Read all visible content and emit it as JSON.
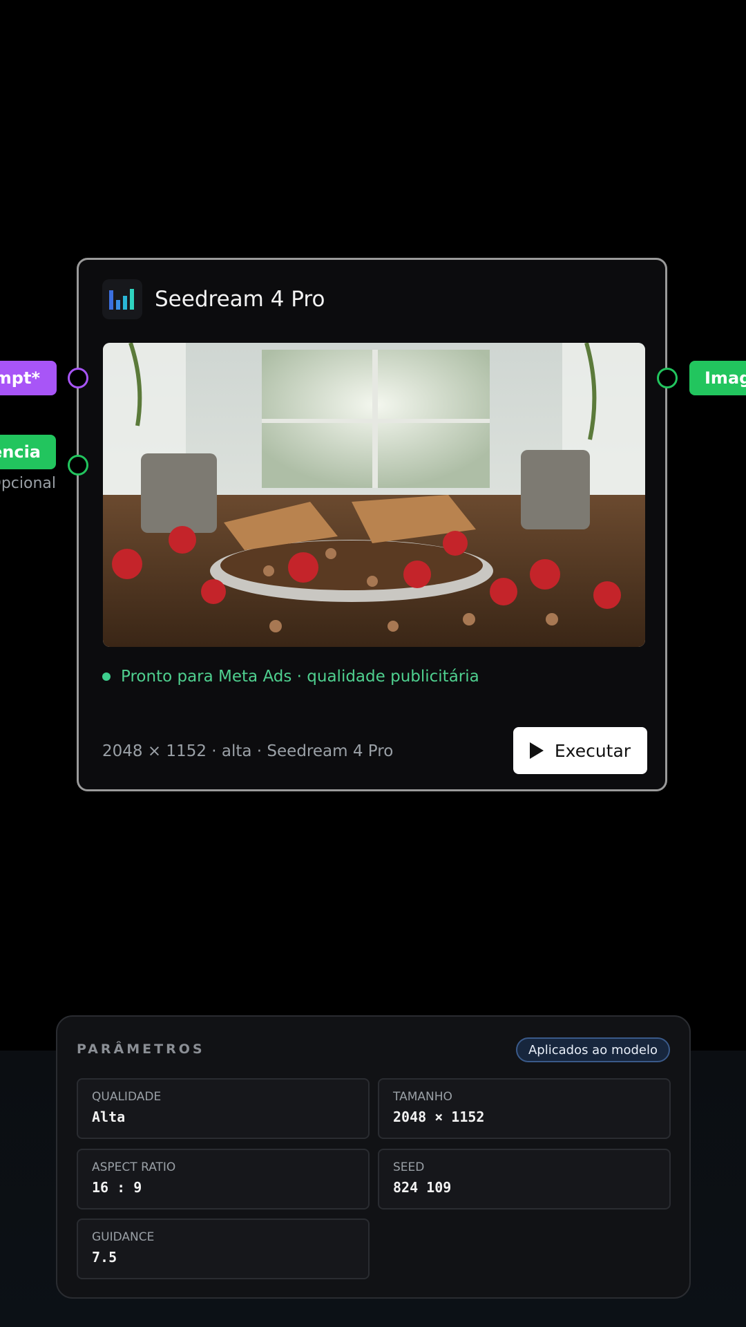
{
  "node": {
    "title": "Seedream 4 Pro",
    "status": "Pronto para Meta Ads · qualidade publicitária",
    "meta": "2048 × 1152 · alta · Seedream 4 Pro",
    "run_label": "Executar",
    "status_color": "#3ecf8e"
  },
  "inputs": {
    "prompt_label": "Prompt*",
    "prompt_visible": "mpt*",
    "reference_visible": "ência",
    "optional_visible": "Opcional",
    "prompt_color": "#a855f7",
    "reference_color": "#22c55e"
  },
  "outputs": {
    "image_visible": "Imag",
    "image_color": "#22c55e"
  },
  "params": {
    "title": "PARÂMETROS",
    "badge": "Aplicados ao modelo",
    "items": [
      {
        "label": "QUALIDADE",
        "value": "Alta"
      },
      {
        "label": "TAMANHO",
        "value": "2048 × 1152"
      },
      {
        "label": "ASPECT RATIO",
        "value": "16 : 9"
      },
      {
        "label": "SEED",
        "value": "824 109"
      },
      {
        "label": "GUIDANCE",
        "value": "7.5"
      }
    ]
  },
  "icons": {
    "model_logo": "bar-chart-logo-icon",
    "run": "play-icon"
  }
}
